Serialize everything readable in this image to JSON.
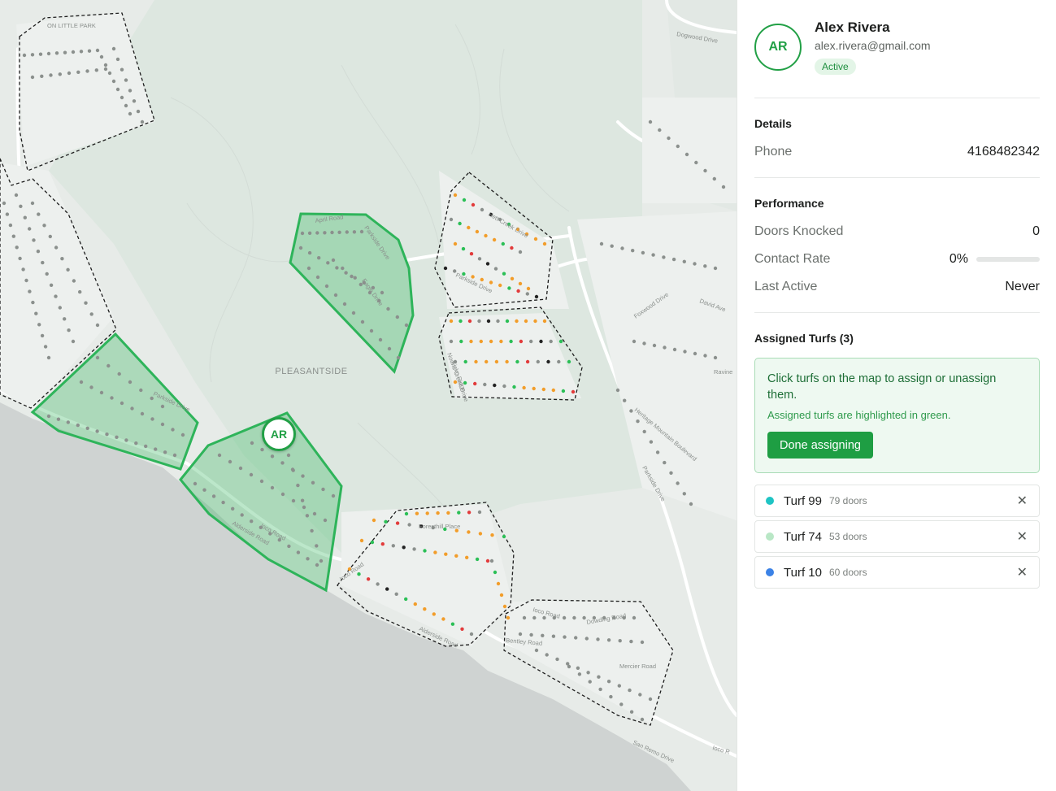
{
  "map": {
    "place_label": "PLEASANTSIDE",
    "marker_initials": "AR",
    "street_labels": [
      "ON LITTLE PARK",
      "Dogwood Drive",
      "April Road",
      "Parkside Drive",
      "Eagle Drive",
      "Hett Creek Drive",
      "Parkside Drive",
      "Noons Creek Drive",
      "David Ave",
      "Foxwood Drive",
      "Heritage Mountain Boulevard",
      "Parkside Drive",
      "Ravine",
      "Foresthill Place",
      "Ioco Road",
      "Ioco Road",
      "Alderside Road",
      "Dowding Road",
      "Bentley Road",
      "Mercier Road",
      "San Remo Drive",
      "Ioco R",
      "Alderside Road",
      "Ioco Road",
      "Parkside Drive",
      "Kicko Ridge"
    ]
  },
  "profile": {
    "initials": "AR",
    "name": "Alex Rivera",
    "email": "alex.rivera@gmail.com",
    "status": "Active"
  },
  "details": {
    "title": "Details",
    "phone_label": "Phone",
    "phone_value": "4168482342"
  },
  "performance": {
    "title": "Performance",
    "doors_label": "Doors Knocked",
    "doors_value": "0",
    "contact_label": "Contact Rate",
    "contact_value": "0%",
    "contact_rate_fraction": 0,
    "last_active_label": "Last Active",
    "last_active_value": "Never"
  },
  "turfs": {
    "title": "Assigned Turfs (3)",
    "info_main": "Click turfs on the map to assign or unassign them.",
    "info_sub": "Assigned turfs are highlighted in green.",
    "done_label": "Done assigning",
    "remove_icon": "close-icon",
    "items": [
      {
        "name": "Turf 99",
        "doors": "79 doors",
        "color": "#1fc4c4"
      },
      {
        "name": "Turf 74",
        "doors": "53 doors",
        "color": "#b9e7c6"
      },
      {
        "name": "Turf 10",
        "doors": "60 doors",
        "color": "#3b82e6"
      }
    ]
  },
  "colors": {
    "accent": "#22a046",
    "dot_grey": "#8b908d",
    "dot_orange": "#f29d2a",
    "dot_green": "#2bbf56",
    "dot_red": "#e23b3b",
    "dot_black": "#222222"
  }
}
